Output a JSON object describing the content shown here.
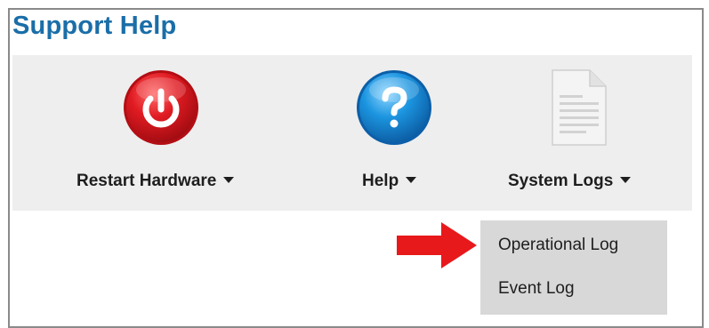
{
  "page": {
    "title": "Support Help"
  },
  "toolbar": {
    "items": [
      {
        "label": "Restart Hardware",
        "icon": "power-icon",
        "color": "#d0161d"
      },
      {
        "label": "Help",
        "icon": "help-question-icon",
        "color": "#1b8fd8"
      },
      {
        "label": "System Logs",
        "icon": "document-icon",
        "color": "#e0e0e0"
      }
    ]
  },
  "dropdown": {
    "items": [
      {
        "label": "Operational Log"
      },
      {
        "label": "Event Log"
      }
    ]
  },
  "annotation": {
    "icon": "red-arrow-icon",
    "color": "#e8191b"
  }
}
